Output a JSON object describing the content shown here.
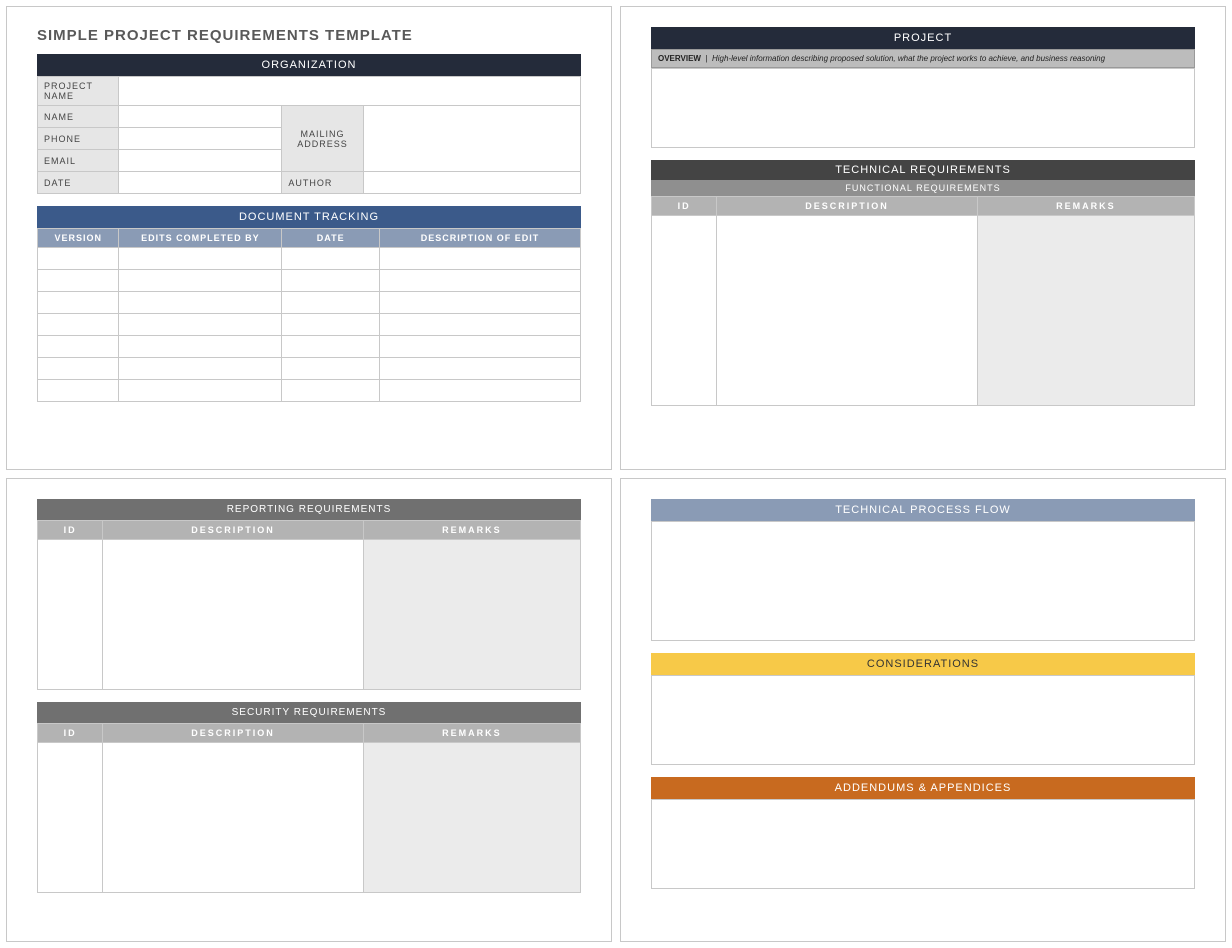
{
  "template_title": "SIMPLE PROJECT REQUIREMENTS TEMPLATE",
  "organization": {
    "header": "ORGANIZATION",
    "project_name_label": "PROJECT NAME",
    "name_label": "NAME",
    "phone_label": "PHONE",
    "email_label": "EMAIL",
    "date_label": "DATE",
    "mailing_address_label": "MAILING ADDRESS",
    "author_label": "AUTHOR"
  },
  "document_tracking": {
    "header": "DOCUMENT TRACKING",
    "columns": {
      "version": "VERSION",
      "edits_by": "EDITS COMPLETED BY",
      "date": "DATE",
      "description": "DESCRIPTION OF EDIT"
    }
  },
  "project": {
    "header": "PROJECT",
    "overview_label": "OVERVIEW",
    "overview_desc": "High-level information describing proposed solution, what the project works to achieve, and business reasoning"
  },
  "technical_requirements": {
    "header": "TECHNICAL REQUIREMENTS",
    "functional_header": "FUNCTIONAL REQUIREMENTS",
    "columns": {
      "id": "ID",
      "description": "DESCRIPTION",
      "remarks": "REMARKS"
    }
  },
  "reporting_requirements": {
    "header": "REPORTING REQUIREMENTS",
    "columns": {
      "id": "ID",
      "description": "DESCRIPTION",
      "remarks": "REMARKS"
    }
  },
  "security_requirements": {
    "header": "SECURITY REQUIREMENTS",
    "columns": {
      "id": "ID",
      "description": "DESCRIPTION",
      "remarks": "REMARKS"
    }
  },
  "technical_process_flow": {
    "header": "TECHNICAL PROCESS FLOW"
  },
  "considerations": {
    "header": "CONSIDERATIONS"
  },
  "addendums": {
    "header": "ADDENDUMS & APPENDICES"
  }
}
